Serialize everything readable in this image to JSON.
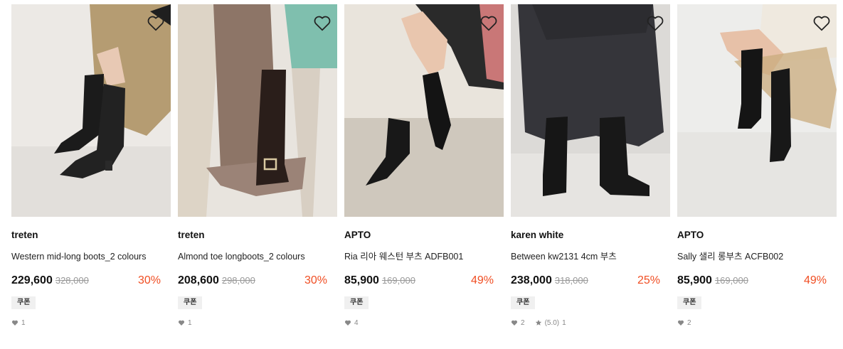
{
  "products": [
    {
      "brand": "treten",
      "title": "Western mid-long boots_2 colours",
      "price": "229,600",
      "original_price": "328,000",
      "discount": "30%",
      "coupon": "쿠폰",
      "likes": "1",
      "rating": null,
      "reviews": null,
      "photo": "woman in tan skirt wearing black western mid-long boots",
      "palette": {
        "bg": "#ece9e5",
        "floor": "#e2dfdb",
        "cloth": "#b59c72",
        "boot": "#1b1b1b"
      }
    },
    {
      "brand": "treten",
      "title": "Almond toe longboots_2 colours",
      "price": "208,600",
      "original_price": "298,000",
      "discount": "30%",
      "coupon": "쿠폰",
      "likes": "1",
      "rating": null,
      "reviews": null,
      "photo": "tall brown buckle longboot on draped fabric",
      "palette": {
        "bg": "#e8e4de",
        "floor": "#e4e1dc",
        "cloth": "#9b8377",
        "boot": "#2a1e1a"
      }
    },
    {
      "brand": "APTO",
      "title": "Ria 리아 웨스턴 부츠 ADFB001",
      "price": "85,900",
      "original_price": "169,000",
      "discount": "49%",
      "coupon": "쿠폰",
      "likes": "4",
      "rating": null,
      "reviews": null,
      "photo": "seated woman wearing black ankle western boots",
      "palette": {
        "bg": "#e9e4dc",
        "floor": "#cfc8bd",
        "cloth": "#2a2a2a",
        "boot": "#141414"
      }
    },
    {
      "brand": "karen white",
      "title": "Between kw2131 4cm 부츠",
      "price": "238,000",
      "original_price": "318,000",
      "discount": "25%",
      "coupon": "쿠폰",
      "likes": "2",
      "rating": "(5.0)",
      "reviews": "1",
      "photo": "woman in long dark skirt wearing black ankle boots",
      "palette": {
        "bg": "#dcdad7",
        "floor": "#e6e4e1",
        "cloth": "#35353a",
        "boot": "#161616"
      }
    },
    {
      "brand": "APTO",
      "title": "Sally 샐리 롱부츠 ACFB002",
      "price": "85,900",
      "original_price": "169,000",
      "discount": "49%",
      "coupon": "쿠폰",
      "likes": "2",
      "rating": null,
      "reviews": null,
      "photo": "woman on rattan chair wearing black tall western boots",
      "palette": {
        "bg": "#ededeb",
        "floor": "#e6e5e2",
        "cloth": "#efe9df",
        "boot": "#151515"
      }
    }
  ],
  "colors": {
    "discount": "#f04e23",
    "price": "#111111",
    "original_price": "#999999",
    "coupon_bg": "#f0f0f0",
    "meta": "#888888"
  },
  "icons": {
    "wishlist": "heart-outline-icon",
    "likes": "heart-filled-icon",
    "rating": "star-filled-icon"
  }
}
